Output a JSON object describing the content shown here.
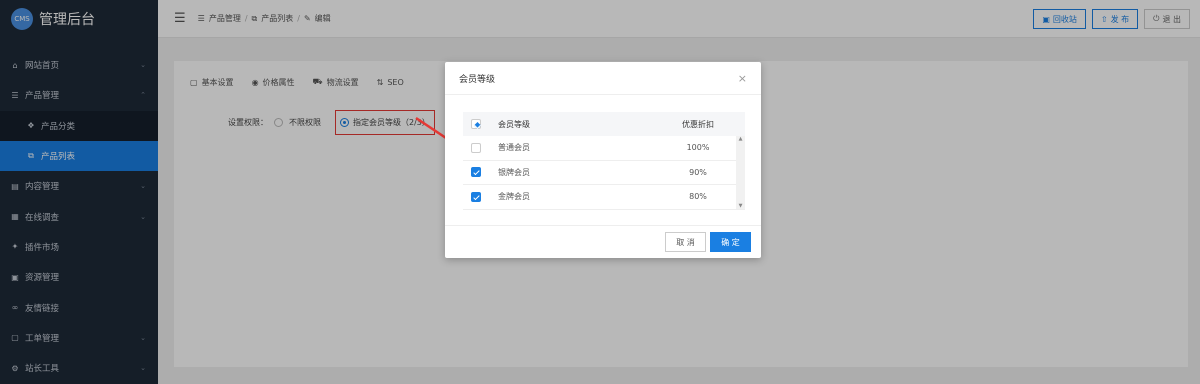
{
  "app": {
    "logo": "CMS",
    "title": "管理后台"
  },
  "nav": [
    {
      "label": "网站首页",
      "icon": "home-icon",
      "glyph": "⌂",
      "caret": "⌄"
    },
    {
      "label": "产品管理",
      "icon": "list-icon",
      "glyph": "☰",
      "caret": "⌃"
    },
    {
      "label": "产品分类",
      "icon": "category-icon",
      "glyph": "❖",
      "sub": true
    },
    {
      "label": "产品列表",
      "icon": "tag-icon",
      "glyph": "⧉",
      "sub": true,
      "active": true
    },
    {
      "label": "内容管理",
      "icon": "content-icon",
      "glyph": "▤",
      "caret": "⌄"
    },
    {
      "label": "在线调查",
      "icon": "survey-icon",
      "glyph": "▦",
      "caret": "⌄"
    },
    {
      "label": "插件市场",
      "icon": "plugin-icon",
      "glyph": "✦"
    },
    {
      "label": "资源管理",
      "icon": "resource-icon",
      "glyph": "▣"
    },
    {
      "label": "友情链接",
      "icon": "link-icon",
      "glyph": "∞"
    },
    {
      "label": "工单管理",
      "icon": "ticket-icon",
      "glyph": "▢",
      "caret": "⌄"
    },
    {
      "label": "站长工具",
      "icon": "tools-icon",
      "glyph": "⚙",
      "caret": "⌄"
    }
  ],
  "breadcrumb": {
    "item1": "产品管理",
    "item2": "产品列表",
    "item3": "编辑",
    "sep": "/"
  },
  "header_buttons": {
    "recycle": "回收站",
    "publish": "发 布",
    "logout": "退 出"
  },
  "tabs": [
    {
      "label": "基本设置",
      "glyph": "▢"
    },
    {
      "label": "价格属性",
      "glyph": "◉"
    },
    {
      "label": "物流设置",
      "glyph": "⛟"
    },
    {
      "label": "SEO",
      "glyph": "⇅"
    }
  ],
  "permission": {
    "label": "设置权限：",
    "opt1": "不限权限",
    "opt2": "指定会员等级（2/3）"
  },
  "modal": {
    "title": "会员等级",
    "close": "×",
    "col_name": "会员等级",
    "col_discount": "优惠折扣",
    "rows": [
      {
        "name": "普通会员",
        "discount": "100%",
        "checked": false
      },
      {
        "name": "银牌会员",
        "discount": "90%",
        "checked": true
      },
      {
        "name": "金牌会员",
        "discount": "80%",
        "checked": true
      }
    ],
    "cancel": "取 消",
    "ok": "确 定"
  },
  "colors": {
    "accent": "#1a7fe2",
    "highlight": "#e53935",
    "sidebar": "#1e2a38"
  }
}
